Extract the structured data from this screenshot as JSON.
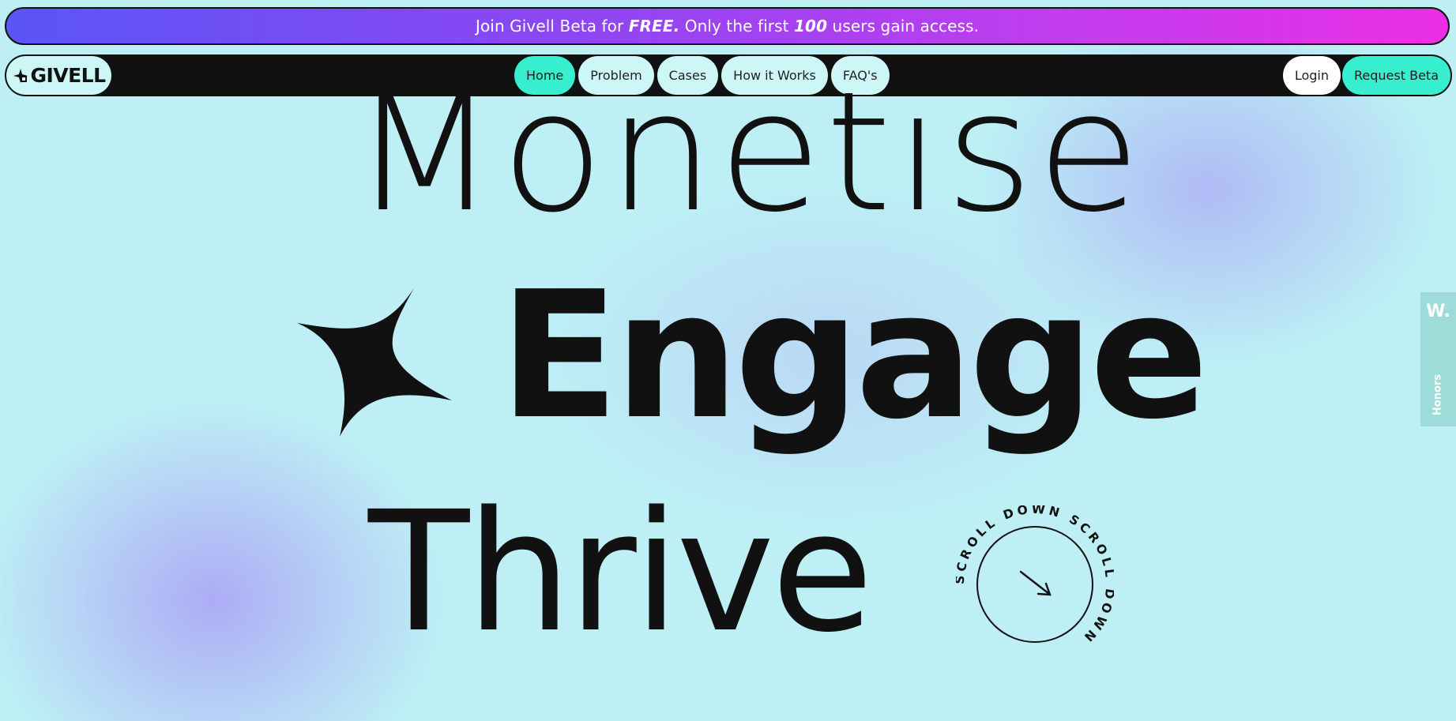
{
  "banner": {
    "text_1": "Join Givell Beta for ",
    "bold_1": "FREE.",
    "text_2": " Only the first ",
    "bold_2": "100",
    "text_3": " users gain access."
  },
  "nav": {
    "logo": "GIVELL",
    "items": [
      {
        "label": "Home",
        "active": true
      },
      {
        "label": "Problem"
      },
      {
        "label": "Cases"
      },
      {
        "label": "How it Works"
      },
      {
        "label": "FAQ's"
      }
    ],
    "login": "Login",
    "request_beta": "Request Beta"
  },
  "hero": {
    "line_1": "Monetise",
    "line_2": "Engage",
    "line_3": "Thrive",
    "scroll_text": "SCROLL DOWN SCROLL DOWN "
  },
  "side_tab": {
    "badge": "W.",
    "label": "Honors"
  },
  "colors": {
    "accent": "#37eecf",
    "pill_bg": "#cdf6f7",
    "banner_start": "#5a55f6",
    "banner_end": "#ea2fe6",
    "ink": "#111111"
  }
}
